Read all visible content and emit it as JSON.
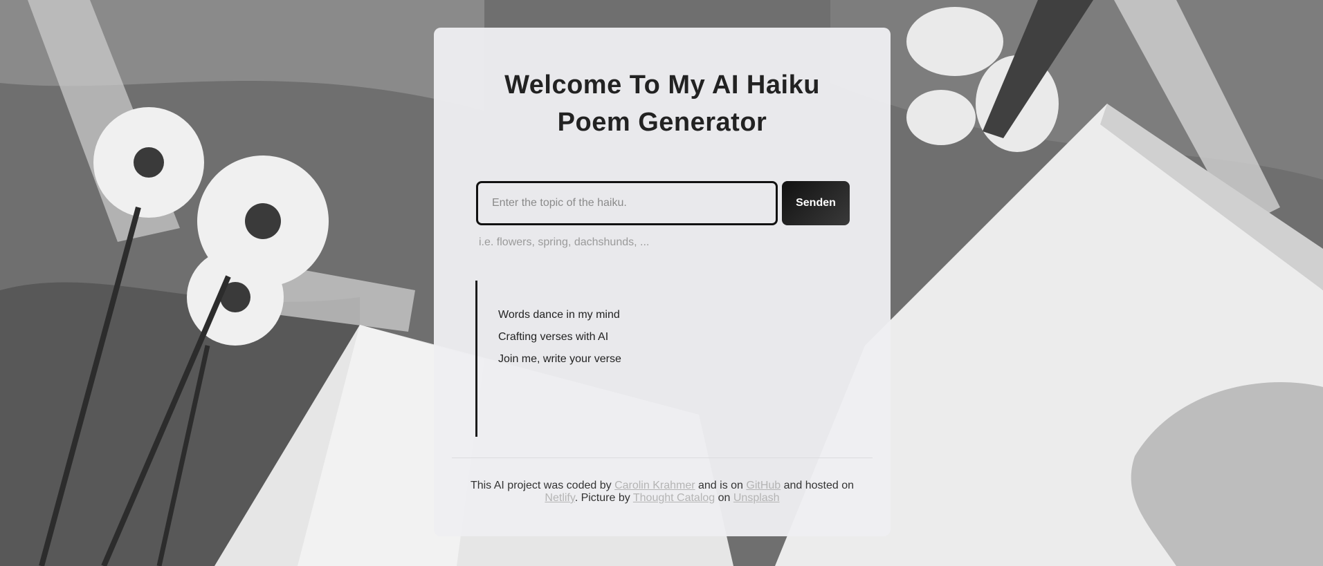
{
  "page": {
    "title_line1": "Welcome To My AI Haiku",
    "title_line2": "Poem Generator"
  },
  "form": {
    "placeholder": "Enter the topic of the haiku.",
    "submit_label": "Senden",
    "hint": "i.e. flowers, spring, dachshunds, ..."
  },
  "poem": {
    "lines": [
      "Words dance in my mind",
      "Crafting verses with AI",
      "Join me, write your verse"
    ]
  },
  "footer": {
    "text1": "This AI project was coded by ",
    "author_link": "Carolin Krahmer",
    "text2": " and is on ",
    "github_link": "GitHub",
    "text3": " and hosted on",
    "netlify_link": "Netlify",
    "text4": ". Picture by ",
    "photographer_link": "Thought Catalog",
    "text5": " on ",
    "unsplash_link": "Unsplash"
  },
  "colors": {
    "card": "#eeeef1",
    "text": "#222222",
    "button": "#111111",
    "link": "#b4b4b4",
    "hint": "#9a9a9a"
  }
}
